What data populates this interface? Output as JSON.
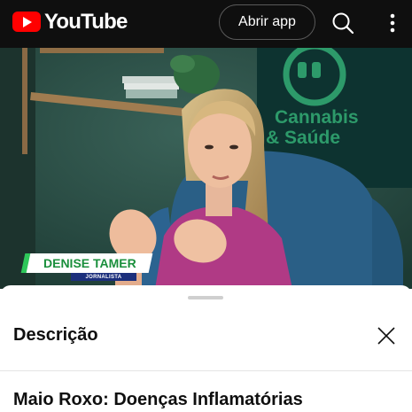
{
  "header": {
    "logo_text": "YouTube",
    "open_app_label": "Abrir app"
  },
  "video": {
    "lower_third_name": "DENISE TAMER",
    "lower_third_role": "JORNALISTA",
    "poster_text_line1": "Cannabis",
    "poster_text_line2": "& Saúde"
  },
  "description_panel": {
    "heading": "Descrição",
    "video_title": "Maio Roxo: Doenças Inflamatórias"
  },
  "icons": {
    "logo": "youtube-logo-icon",
    "search": "search-icon",
    "menu": "more-vertical-icon",
    "close": "close-icon"
  },
  "colors": {
    "topbar": "#0f0f0f",
    "brand_red": "#ff0000",
    "lower_third_green": "#1a8f3c",
    "lower_third_blue": "#1c2f7c"
  }
}
